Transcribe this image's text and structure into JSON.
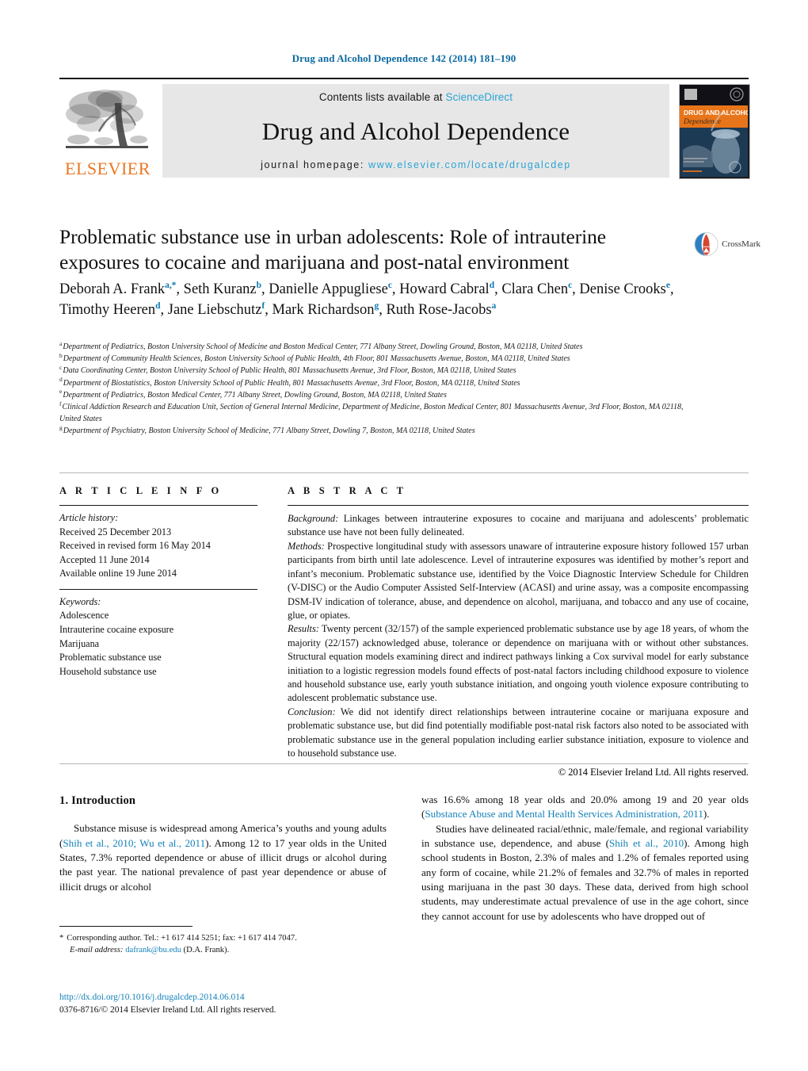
{
  "running_head": "Drug and Alcohol Dependence 142 (2014) 181–190",
  "header": {
    "contents_prefix": "Contents lists available at ",
    "sciencedirect": "ScienceDirect",
    "journal_title": "Drug and Alcohol Dependence",
    "homepage_label": "journal homepage: ",
    "homepage_url": "www.elsevier.com/locate/drugalcdep",
    "publisher": "ELSEVIER",
    "cover_line1": "DRUG AND ALCOHOL",
    "cover_line2": "Dependence",
    "accent_blue": "#2aa3d4",
    "elsevier_orange": "#E87722"
  },
  "title": "Problematic substance use in urban adolescents: Role of intrauterine exposures to cocaine and marijuana and post-natal environment",
  "crossmark": {
    "label": "CrossMark"
  },
  "authors": [
    {
      "name": "Deborah A. Frank",
      "marks": "a,*"
    },
    {
      "name": "Seth Kuranz",
      "marks": "b"
    },
    {
      "name": "Danielle Appugliese",
      "marks": "c"
    },
    {
      "name": "Howard Cabral",
      "marks": "d"
    },
    {
      "name": "Clara Chen",
      "marks": "c"
    },
    {
      "name": "Denise Crooks",
      "marks": "e"
    },
    {
      "name": "Timothy Heeren",
      "marks": "d"
    },
    {
      "name": "Jane Liebschutz",
      "marks": "f"
    },
    {
      "name": "Mark Richardson",
      "marks": "g"
    },
    {
      "name": "Ruth Rose-Jacobs",
      "marks": "a"
    }
  ],
  "affiliations": [
    {
      "mark": "a",
      "text": "Department of Pediatrics, Boston University School of Medicine and Boston Medical Center, 771 Albany Street, Dowling Ground, Boston, MA 02118, United States"
    },
    {
      "mark": "b",
      "text": "Department of Community Health Sciences, Boston University School of Public Health, 4th Floor, 801 Massachusetts Avenue, Boston, MA 02118, United States"
    },
    {
      "mark": "c",
      "text": "Data Coordinating Center, Boston University School of Public Health, 801 Massachusetts Avenue, 3rd Floor, Boston, MA 02118, United States"
    },
    {
      "mark": "d",
      "text": "Department of Biostatistics, Boston University School of Public Health, 801 Massachusetts Avenue, 3rd Floor, Boston, MA 02118, United States"
    },
    {
      "mark": "e",
      "text": "Department of Pediatrics, Boston Medical Center, 771 Albany Street, Dowling Ground, Boston, MA 02118, United States"
    },
    {
      "mark": "f",
      "text": "Clinical Addiction Research and Education Unit, Section of General Internal Medicine, Department of Medicine, Boston Medical Center, 801 Massachusetts Avenue, 3rd Floor, Boston, MA 02118, United States"
    },
    {
      "mark": "g",
      "text": "Department of Psychiatry, Boston University School of Medicine, 771 Albany Street, Dowling 7, Boston, MA 02118, United States"
    }
  ],
  "article_info": {
    "heading": "A R T I C L E   I N F O",
    "history_label": "Article history:",
    "history": [
      "Received 25 December 2013",
      "Received in revised form 16 May 2014",
      "Accepted 11 June 2014",
      "Available online 19 June 2014"
    ],
    "keywords_label": "Keywords:",
    "keywords": [
      "Adolescence",
      "Intrauterine cocaine exposure",
      "Marijuana",
      "Problematic substance use",
      "Household substance use"
    ]
  },
  "abstract": {
    "heading": "A B S T R A C T",
    "sections": [
      {
        "label": "Background:",
        "text": " Linkages between intrauterine exposures to cocaine and marijuana and adolescents’ problematic substance use have not been fully delineated."
      },
      {
        "label": "Methods:",
        "text": " Prospective longitudinal study with assessors unaware of intrauterine exposure history followed 157 urban participants from birth until late adolescence. Level of intrauterine exposures was identified by mother’s report and infant’s meconium. Problematic substance use, identified by the Voice Diagnostic Interview Schedule for Children (V-DISC) or the Audio Computer Assisted Self-Interview (ACASI) and urine assay, was a composite encompassing DSM-IV indication of tolerance, abuse, and dependence on alcohol, marijuana, and tobacco and any use of cocaine, glue, or opiates."
      },
      {
        "label": "Results:",
        "text": " Twenty percent (32/157) of the sample experienced problematic substance use by age 18 years, of whom the majority (22/157) acknowledged abuse, tolerance or dependence on marijuana with or without other substances. Structural equation models examining direct and indirect pathways linking a Cox survival model for early substance initiation to a logistic regression models found effects of post-natal factors including childhood exposure to violence and household substance use, early youth substance initiation, and ongoing youth violence exposure contributing to adolescent problematic substance use."
      },
      {
        "label": "Conclusion:",
        "text": " We did not identify direct relationships between intrauterine cocaine or marijuana exposure and problematic substance use, but did find potentially modifiable post-natal risk factors also noted to be associated with problematic substance use in the general population including earlier substance initiation, exposure to violence and to household substance use."
      }
    ],
    "copyright": "© 2014 Elsevier Ireland Ltd. All rights reserved."
  },
  "body": {
    "section_heading": "1. Introduction",
    "left_column": {
      "para1_part1": "Substance misuse is widespread among America’s youths and young adults (",
      "para1_ref1": "Shih et al., 2010; Wu et al., 2011",
      "para1_part2": "). Among 12 to 17 year olds in the United States, 7.3% reported dependence or abuse of illicit drugs or alcohol during the past year. The national prevalence of past year dependence or abuse of illicit drugs or alcohol"
    },
    "right_column": {
      "para1_cont_part1": "was 16.6% among 18 year olds and 20.0% among 19 and 20 year olds (",
      "para1_cont_ref": "Substance Abuse and Mental Health Services Administration, 2011",
      "para1_cont_part2": ").",
      "para2_part1": "Studies have delineated racial/ethnic, male/female, and regional variability in substance use, dependence, and abuse (",
      "para2_ref": "Shih et al., 2010",
      "para2_part2": "). Among high school students in Boston, 2.3% of males and 1.2% of females reported using any form of cocaine, while 21.2% of females and 32.7% of males in reported using marijuana in the past 30 days. These data, derived from high school students, may underestimate actual prevalence of use in the age cohort, since they cannot account for use by adolescents who have dropped out of"
    }
  },
  "footnote": {
    "star": "*",
    "corresponding": "Corresponding author. Tel.: +1 617 414 5251; fax: +1 617 414 7047.",
    "email_label": "E-mail address:",
    "email": "dafrank@bu.edu",
    "email_suffix": "(D.A. Frank)."
  },
  "doi": {
    "url": "http://dx.doi.org/10.1016/j.drugalcdep.2014.06.014",
    "issn_line": "0376-8716/© 2014 Elsevier Ireland Ltd. All rights reserved."
  }
}
